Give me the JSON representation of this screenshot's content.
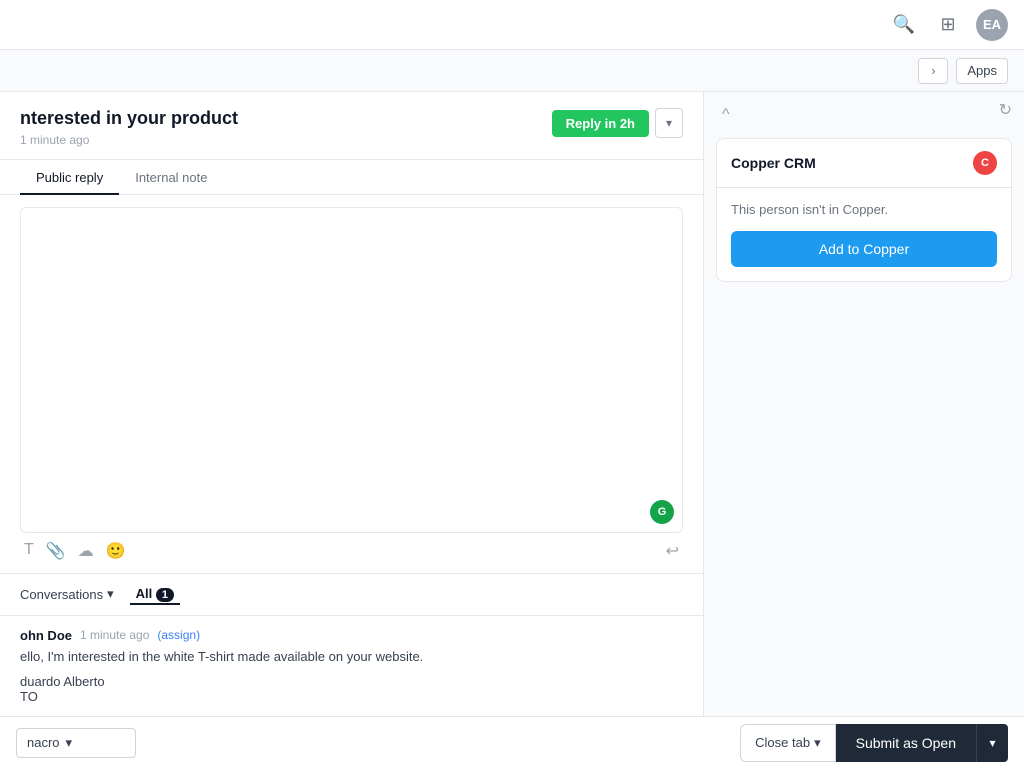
{
  "topNav": {
    "searchIcon": "🔍",
    "appsGridIcon": "⊞",
    "avatarInitials": "EA"
  },
  "subNav": {
    "chevronLabel": "›",
    "appsLabel": "Apps"
  },
  "ticket": {
    "title": "nterested in your product",
    "time": "1 minute ago",
    "replyBtnLabel": "Reply in 2h",
    "collapseIcon": "^"
  },
  "replyTabs": [
    {
      "label": "Public reply",
      "active": true
    },
    {
      "label": "Internal note",
      "active": false
    }
  ],
  "editor": {
    "grammarlyLetter": "G"
  },
  "conversations": {
    "label": "Conversations",
    "tabs": [
      {
        "label": "All",
        "badge": "1",
        "active": true
      }
    ],
    "items": [
      {
        "sender": "ohn Doe",
        "time": "1 minute ago",
        "assignLabel": "(assign)",
        "message": "ello, I'm interested in the white T-shirt made available on your website.",
        "signature1": "duardo Alberto",
        "signature2": "TO"
      }
    ]
  },
  "rightPanel": {
    "crm": {
      "title": "Copper CRM",
      "logoLetter": "C",
      "message": "This person isn't in Copper.",
      "addBtnLabel": "Add to Copper"
    }
  },
  "bottomBar": {
    "macroPlaceholder": "nacro",
    "closeTabLabel": "Close tab",
    "submitLabel": "Submit as Open"
  }
}
